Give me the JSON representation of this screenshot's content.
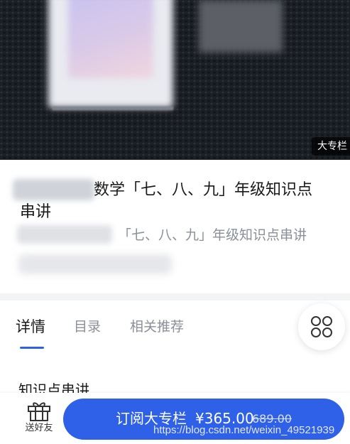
{
  "hero": {
    "badge": "大专栏"
  },
  "course": {
    "title_line1": "数学「七、八、九」年级知识点",
    "title_line2": "串讲",
    "subtitle": "「七、八、九」年级知识点串讲"
  },
  "tabs": [
    {
      "label": "详情",
      "active": true
    },
    {
      "label": "目录",
      "active": false
    },
    {
      "label": "相关推荐",
      "active": false
    }
  ],
  "section_peek": "知识点串讲",
  "bottom_bar": {
    "gift_label": "送好友",
    "subscribe_label": "订阅大专栏",
    "price": "¥365.00",
    "original_price": "689.00"
  },
  "watermark": "https://blog.csdn.net/weixin_49521939",
  "colors": {
    "accent": "#2f61e8",
    "hero_bg": "#1b1f26",
    "muted_text": "#8a8f99"
  },
  "icons": [
    "gift-icon",
    "grid-menu-icon"
  ]
}
